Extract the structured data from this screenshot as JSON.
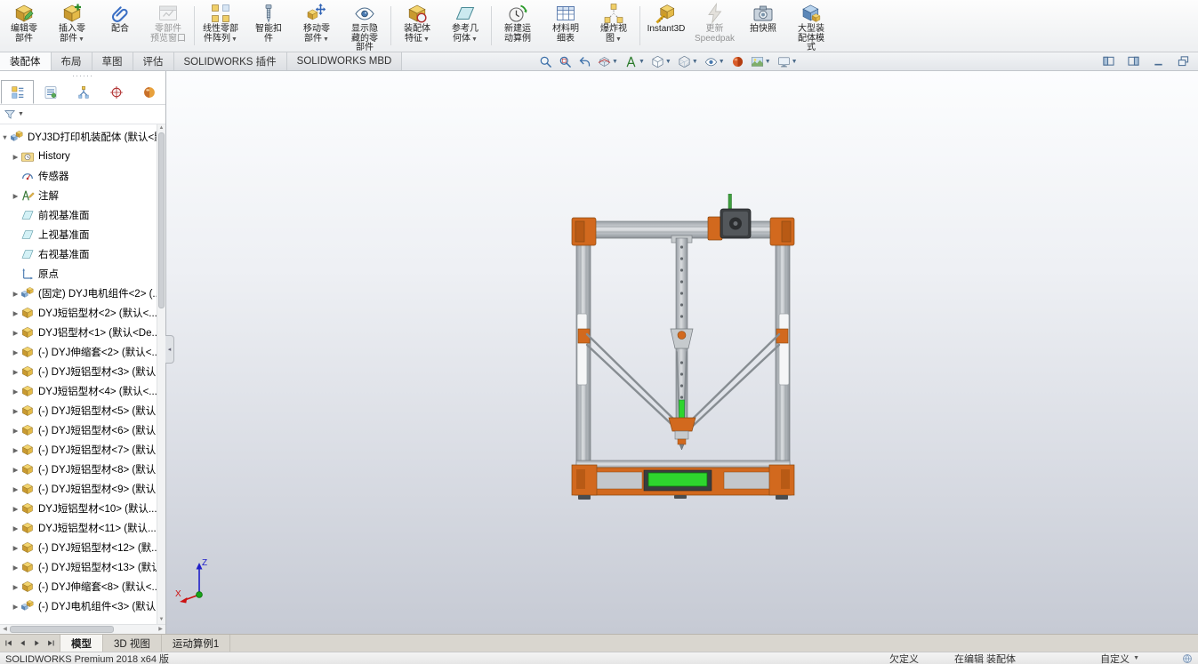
{
  "colors": {
    "accent_orange": "#d2691e",
    "lcd_green": "#2ed52e",
    "viewport_gradient_top": "#fcfdfe",
    "viewport_gradient_bottom": "#c6cad4",
    "toolbar_icon_blue": "#3a6ea8"
  },
  "ribbon": {
    "items": [
      {
        "id": "edit-component",
        "label": "编辑零部件",
        "display": "编辑零\n部件",
        "icon": "edit-component",
        "dropdown": false,
        "disabled": false
      },
      {
        "id": "insert-component",
        "label": "插入零部件",
        "display": "插入零\n部件",
        "icon": "insert-component",
        "dropdown": true,
        "disabled": false
      },
      {
        "id": "mate",
        "label": "配合",
        "display": "配合",
        "icon": "mate",
        "dropdown": false,
        "disabled": false
      },
      {
        "id": "component-preview-window",
        "label": "零部件预览窗口",
        "display": "零部件\n预览窗口",
        "icon": "preview-window",
        "dropdown": false,
        "disabled": true
      },
      {
        "id": "linear-component-pattern",
        "label": "线性零部件阵列",
        "display": "线性零部\n件阵列",
        "icon": "linear-pattern",
        "dropdown": true,
        "disabled": false,
        "sep_before": true
      },
      {
        "id": "smart-fasteners",
        "label": "智能扣件",
        "display": "智能扣\n件",
        "icon": "smart-fasteners",
        "dropdown": false,
        "disabled": false
      },
      {
        "id": "move-component",
        "label": "移动零部件",
        "display": "移动零\n部件",
        "icon": "move-component",
        "dropdown": true,
        "disabled": false
      },
      {
        "id": "show-hidden-components",
        "label": "显示隐藏的零部件",
        "display": "显示隐\n藏的零\n部件",
        "icon": "show-hidden",
        "dropdown": false,
        "disabled": false
      },
      {
        "id": "assembly-features",
        "label": "装配体特征",
        "display": "装配体\n特征",
        "icon": "assembly-features",
        "dropdown": true,
        "disabled": false,
        "sep_before": true
      },
      {
        "id": "reference-geometry",
        "label": "参考几何体",
        "display": "参考几\n何体",
        "icon": "reference-geometry",
        "dropdown": true,
        "disabled": false
      },
      {
        "id": "new-motion-study",
        "label": "新建运动算例",
        "display": "新建运\n动算例",
        "icon": "motion-study",
        "dropdown": false,
        "disabled": false,
        "sep_before": true
      },
      {
        "id": "bill-of-materials",
        "label": "材料明细表",
        "display": "材料明\n细表",
        "icon": "bom",
        "dropdown": false,
        "disabled": false
      },
      {
        "id": "exploded-view",
        "label": "爆炸视图",
        "display": "爆炸视\n图",
        "icon": "exploded-view",
        "dropdown": true,
        "disabled": false
      },
      {
        "id": "instant3d",
        "label": "Instant3D",
        "display": "Instant3D",
        "icon": "instant3d",
        "dropdown": false,
        "disabled": false,
        "sep_before": true
      },
      {
        "id": "update-speedpak",
        "label": "更新Speedpak",
        "display": "更新\nSpeedpak",
        "icon": "speedpak",
        "dropdown": false,
        "disabled": true
      },
      {
        "id": "take-snapshot",
        "label": "拍快照",
        "display": "拍快照",
        "icon": "snapshot",
        "dropdown": false,
        "disabled": false
      },
      {
        "id": "large-assembly-mode",
        "label": "大型装配体模式",
        "display": "大型装\n配体模\n式",
        "icon": "large-assembly",
        "dropdown": false,
        "disabled": false
      }
    ]
  },
  "command_tabs": {
    "items": [
      {
        "id": "assembly",
        "label": "装配体",
        "active": true
      },
      {
        "id": "layout",
        "label": "布局",
        "active": false
      },
      {
        "id": "sketch",
        "label": "草图",
        "active": false
      },
      {
        "id": "evaluate",
        "label": "评估",
        "active": false
      },
      {
        "id": "sw-addins",
        "label": "SOLIDWORKS 插件",
        "active": false
      },
      {
        "id": "sw-mbd",
        "label": "SOLIDWORKS MBD",
        "active": false
      }
    ]
  },
  "headsup": {
    "items": [
      {
        "id": "zoom-to-fit",
        "icon": "zoom-fit",
        "dropdown": false
      },
      {
        "id": "zoom-to-area",
        "icon": "zoom-area",
        "dropdown": false
      },
      {
        "id": "previous-view",
        "icon": "previous-view",
        "dropdown": false
      },
      {
        "id": "section-view",
        "icon": "section-view",
        "dropdown": true
      },
      {
        "id": "dynamic-annotation-views",
        "icon": "annotation-view",
        "dropdown": true
      },
      {
        "id": "view-orientation",
        "icon": "view-cube",
        "dropdown": true
      },
      {
        "id": "display-style",
        "icon": "display-style",
        "dropdown": true
      },
      {
        "id": "hide-show-items",
        "icon": "eye",
        "dropdown": true
      },
      {
        "id": "edit-appearance",
        "icon": "appearance-sphere",
        "dropdown": false
      },
      {
        "id": "apply-scene",
        "icon": "scene",
        "dropdown": true
      },
      {
        "id": "view-settings",
        "icon": "monitor",
        "dropdown": true
      }
    ]
  },
  "window_controls": {
    "items": [
      {
        "id": "collapse-left-pane",
        "icon": "pane-left"
      },
      {
        "id": "expand-right-pane",
        "icon": "pane-right"
      },
      {
        "id": "minimize-pane",
        "icon": "pane-min"
      },
      {
        "id": "float-pane",
        "icon": "pane-float"
      }
    ]
  },
  "panel": {
    "tabs": {
      "items": [
        {
          "id": "featuremanager",
          "icon": "featuremanager-tab",
          "active": true
        },
        {
          "id": "propertymanager",
          "icon": "propertymanager-tab",
          "active": false
        },
        {
          "id": "configurationmanager",
          "icon": "configurationmanager-tab",
          "active": false
        },
        {
          "id": "dimxpertmanager",
          "icon": "dimxpertmanager-tab",
          "active": false
        },
        {
          "id": "displaymanager",
          "icon": "displaymanager-tab",
          "active": false
        }
      ]
    },
    "tree": {
      "items": [
        {
          "label": "DYJ3D打印机装配体 (默认<默...",
          "icon": "assembly",
          "caret": "down",
          "level": 0
        },
        {
          "label": "History",
          "icon": "history",
          "caret": "right",
          "level": 1
        },
        {
          "label": "传感器",
          "icon": "sensors",
          "caret": "",
          "level": 1
        },
        {
          "label": "注解",
          "icon": "annotations",
          "caret": "right",
          "level": 1
        },
        {
          "label": "前视基准面",
          "icon": "plane",
          "caret": "",
          "level": 1
        },
        {
          "label": "上视基准面",
          "icon": "plane",
          "caret": "",
          "level": 1
        },
        {
          "label": "右视基准面",
          "icon": "plane",
          "caret": "",
          "level": 1
        },
        {
          "label": "原点",
          "icon": "origin",
          "caret": "",
          "level": 1
        },
        {
          "label": "(固定) DYJ电机组件<2> (...",
          "icon": "assembly",
          "caret": "right",
          "level": 1
        },
        {
          "label": "DYJ短铝型材<2> (默认<...",
          "icon": "part",
          "caret": "right",
          "level": 1
        },
        {
          "label": "DYJ铝型材<1> (默认<De...",
          "icon": "part",
          "caret": "right",
          "level": 1
        },
        {
          "label": "(-) DYJ伸缩套<2> (默认<...",
          "icon": "part",
          "caret": "right",
          "level": 1
        },
        {
          "label": "(-) DYJ短铝型材<3> (默认...",
          "icon": "part",
          "caret": "right",
          "level": 1
        },
        {
          "label": "DYJ短铝型材<4> (默认<...",
          "icon": "part",
          "caret": "right",
          "level": 1
        },
        {
          "label": "(-) DYJ短铝型材<5> (默认...",
          "icon": "part",
          "caret": "right",
          "level": 1
        },
        {
          "label": "(-) DYJ短铝型材<6> (默认...",
          "icon": "part",
          "caret": "right",
          "level": 1
        },
        {
          "label": "(-) DYJ短铝型材<7> (默认...",
          "icon": "part",
          "caret": "right",
          "level": 1
        },
        {
          "label": "(-) DYJ短铝型材<8> (默认...",
          "icon": "part",
          "caret": "right",
          "level": 1
        },
        {
          "label": "(-) DYJ短铝型材<9> (默认...",
          "icon": "part",
          "caret": "right",
          "level": 1
        },
        {
          "label": "DYJ短铝型材<10> (默认...",
          "icon": "part",
          "caret": "right",
          "level": 1
        },
        {
          "label": "DYJ短铝型材<11> (默认...",
          "icon": "part",
          "caret": "right",
          "level": 1
        },
        {
          "label": "(-) DYJ短铝型材<12> (默...",
          "icon": "part",
          "caret": "right",
          "level": 1
        },
        {
          "label": "(-) DYJ短铝型材<13> (默认...",
          "icon": "part",
          "caret": "right",
          "level": 1
        },
        {
          "label": "(-) DYJ伸缩套<8> (默认<...",
          "icon": "part",
          "caret": "right",
          "level": 1
        },
        {
          "label": "(-) DYJ电机组件<3> (默认...",
          "icon": "assembly",
          "caret": "right",
          "level": 1
        }
      ]
    }
  },
  "viewport": {
    "triad": {
      "x": "X",
      "z": "Z"
    }
  },
  "bottom_tabs": {
    "nav": [
      {
        "id": "first-tab",
        "icon": "nav-first"
      },
      {
        "id": "previous-tab",
        "icon": "nav-prev"
      },
      {
        "id": "next-tab",
        "icon": "nav-next"
      },
      {
        "id": "last-tab",
        "icon": "nav-last"
      }
    ],
    "items": [
      {
        "id": "model",
        "label": "模型",
        "active": true
      },
      {
        "id": "3d-views",
        "label": "3D 视图",
        "active": false
      },
      {
        "id": "motion-study-1",
        "label": "运动算例1",
        "active": false
      }
    ]
  },
  "status": {
    "left": "SOLIDWORKS Premium 2018 x64 版",
    "items": [
      "欠定义",
      "在编辑 装配体",
      "自定义"
    ]
  }
}
